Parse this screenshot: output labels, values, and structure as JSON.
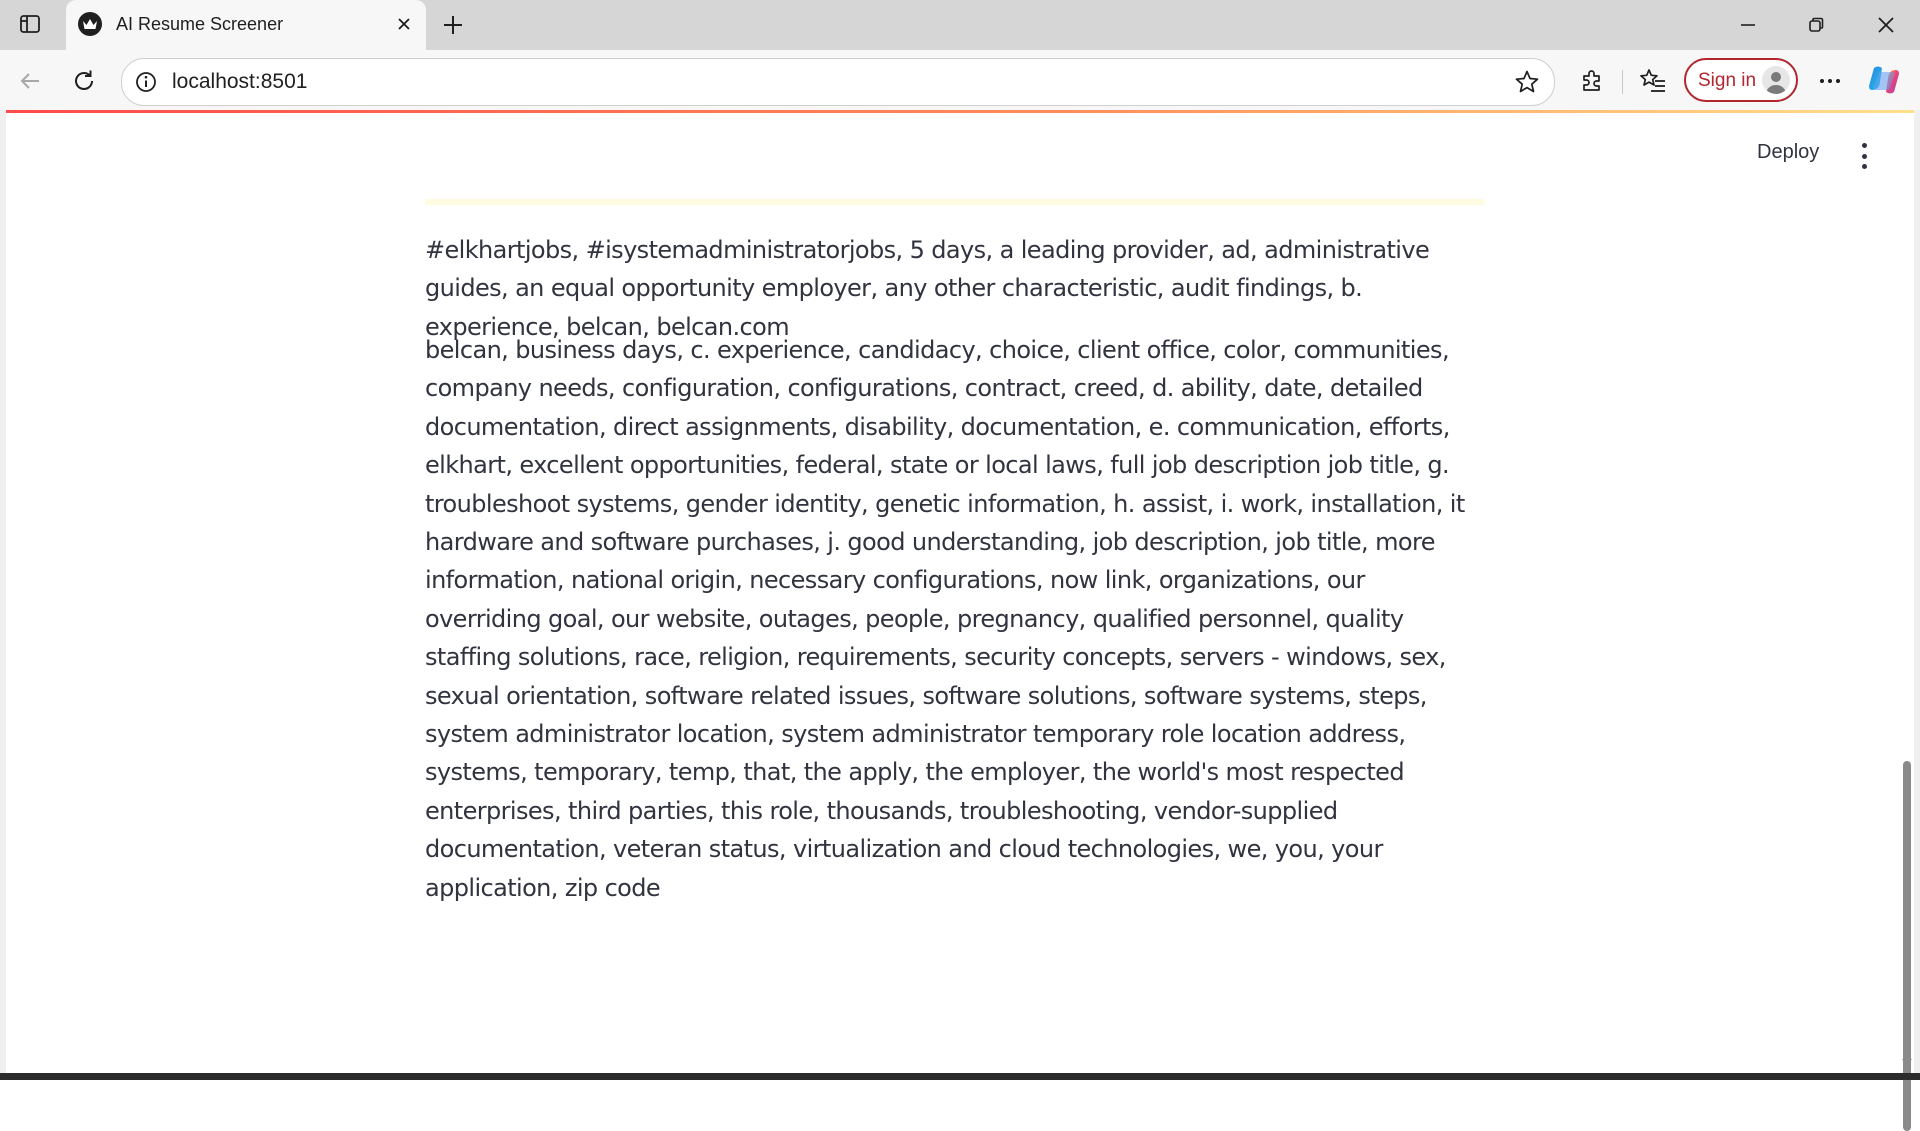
{
  "browser": {
    "tab_title": "AI Resume Screener",
    "url": "localhost:8501",
    "sign_in_label": "Sign in"
  },
  "app": {
    "deploy_label": "Deploy",
    "paragraph1": "#elkhartjobs, #isystemadministratorjobs, 5 days, a leading provider, ad, administrative guides, an equal opportunity employer, any other characteristic, audit findings, b. experience, belcan, belcan.com",
    "paragraph2": "belcan, business days, c. experience, candidacy, choice, client office, color, communities, company needs, configuration, configurations, contract, creed, d. ability, date, detailed documentation, direct assignments, disability, documentation, e. communication, efforts, elkhart, excellent opportunities, federal, state or local laws, full job description job title, g. troubleshoot systems, gender identity, genetic information, h. assist, i. work, installation, it hardware and software purchases, j. good understanding, job description, job title, more information, national origin, necessary configurations, now link, organizations, our overriding goal, our website, outages, people, pregnancy, qualified personnel, quality staffing solutions, race, religion, requirements, security concepts, servers - windows, sex, sexual orientation, software related issues, software solutions, software systems, steps, system administrator location, system administrator temporary role location address, systems, temporary, temp, that, the apply, the employer, the world's most respected enterprises, third parties, this role, thousands, troubleshooting, vendor-supplied documentation, veteran status, virtualization and cloud technologies, we, you, your application, zip code"
  },
  "colors": {
    "accent_red": "#b3262d",
    "text": "#31333f"
  }
}
